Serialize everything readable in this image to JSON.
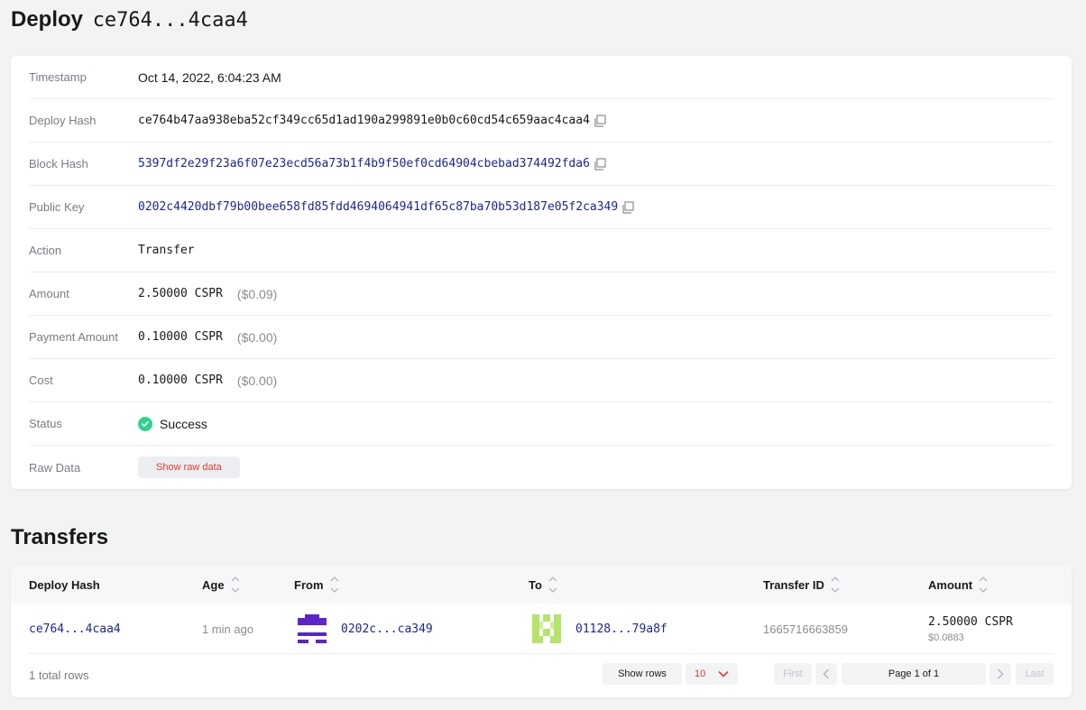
{
  "page": {
    "title_word": "Deploy",
    "title_hash": "ce764...4caa4"
  },
  "details": {
    "timestamp": {
      "label": "Timestamp",
      "value": "Oct 14, 2022, 6:04:23 AM"
    },
    "deploy_hash": {
      "label": "Deploy Hash",
      "value": "ce764b47aa938eba52cf349cc65d1ad190a299891e0b0c60cd54c659aac4caa4"
    },
    "block_hash": {
      "label": "Block Hash",
      "value": "5397df2e29f23a6f07e23ecd56a73b1f4b9f50ef0cd64904cbebad374492fda6"
    },
    "public_key": {
      "label": "Public Key",
      "value": "0202c4420dbf79b00bee658fd85fdd4694064941df65c87ba70b53d187e05f2ca349"
    },
    "action": {
      "label": "Action",
      "value": "Transfer"
    },
    "amount": {
      "label": "Amount",
      "value": "2.50000 CSPR",
      "fiat": "($0.09)"
    },
    "payment_amount": {
      "label": "Payment Amount",
      "value": "0.10000 CSPR",
      "fiat": "($0.00)"
    },
    "cost": {
      "label": "Cost",
      "value": "0.10000 CSPR",
      "fiat": "($0.00)"
    },
    "status": {
      "label": "Status",
      "value": "Success"
    },
    "raw_data": {
      "label": "Raw Data",
      "button": "Show raw data"
    }
  },
  "transfers": {
    "title": "Transfers",
    "columns": [
      "Deploy Hash",
      "Age",
      "From",
      "To",
      "Transfer ID",
      "Amount"
    ],
    "rows": [
      {
        "deploy_hash": "ce764...4caa4",
        "age": "1 min ago",
        "from": "0202c...ca349",
        "to": "01128...79a8f",
        "transfer_id": "1665716663859",
        "amount": "2.50000 CSPR",
        "amount_fiat": "$0.0883"
      }
    ],
    "footer": {
      "total": "1 total rows",
      "show_rows_label": "Show rows",
      "rows_value": "10",
      "first": "First",
      "page": "Page 1 of 1",
      "last": "Last"
    }
  },
  "colors": {
    "link": "#1c2790",
    "accent_red": "#e23a2a",
    "success": "#2fd38f",
    "from_avatar": "#5b25c9",
    "to_avatar": "#b6e36a"
  },
  "icons": [
    "copy-icon",
    "check-icon",
    "sort-icon",
    "chevron-down-icon",
    "chevron-left-icon",
    "chevron-right-icon"
  ]
}
